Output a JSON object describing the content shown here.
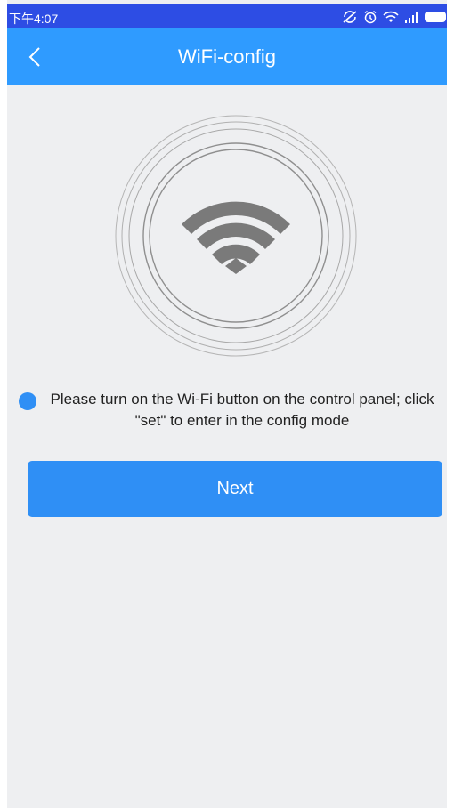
{
  "status_bar": {
    "time": "下午4:07",
    "icons": [
      "sync-off-icon",
      "alarm-icon",
      "wifi-signal-icon",
      "cell-signal-icon",
      "battery-icon"
    ]
  },
  "header": {
    "title": "WiFi-config",
    "back_icon": "chevron-left-icon"
  },
  "illustration": {
    "icon": "wifi-icon",
    "ring_color": "#9a9a9a",
    "wifi_color": "#7a7a7a"
  },
  "tip": {
    "text": "Please turn on the Wi-Fi button on the control panel; click \"set\" to enter in the config mode",
    "bullet_color": "#2f8ff5"
  },
  "next_button": {
    "label": "Next"
  },
  "colors": {
    "header": "#2f9bff",
    "status_bar": "#2d4de4",
    "background": "#eeeff1",
    "primary_button": "#2f8ff5"
  }
}
